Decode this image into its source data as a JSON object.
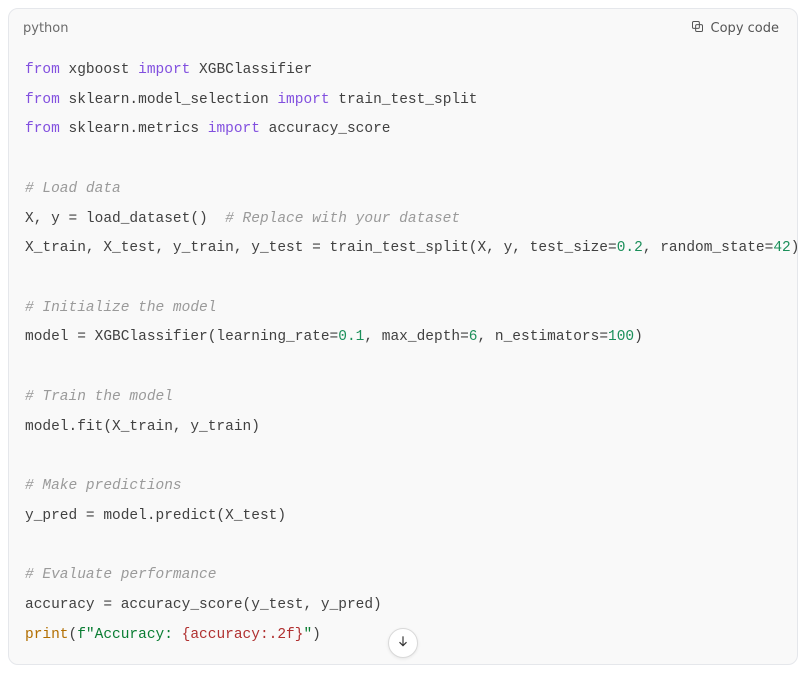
{
  "header": {
    "language": "python",
    "copy_label": "Copy code"
  },
  "code": {
    "lines": [
      "from xgboost import XGBClassifier",
      "from sklearn.model_selection import train_test_split",
      "from sklearn.metrics import accuracy_score",
      "",
      "# Load data",
      "X, y = load_dataset()  # Replace with your dataset",
      "X_train, X_test, y_train, y_test = train_test_split(X, y, test_size=0.2, random_state=42)",
      "",
      "# Initialize the model",
      "model = XGBClassifier(learning_rate=0.1, max_depth=6, n_estimators=100)",
      "",
      "# Train the model",
      "model.fit(X_train, y_train)",
      "",
      "# Make predictions",
      "y_pred = model.predict(X_test)",
      "",
      "# Evaluate performance",
      "accuracy = accuracy_score(y_test, y_pred)",
      "print(f\"Accuracy: {accuracy:.2f}\")"
    ],
    "tokens_by_line": [
      [
        [
          "kw",
          "from"
        ],
        [
          "nm",
          " xgboost "
        ],
        [
          "kw",
          "import"
        ],
        [
          "nm",
          " XGBClassifier"
        ]
      ],
      [
        [
          "kw",
          "from"
        ],
        [
          "nm",
          " sklearn.model_selection "
        ],
        [
          "kw",
          "import"
        ],
        [
          "nm",
          " train_test_split"
        ]
      ],
      [
        [
          "kw",
          "from"
        ],
        [
          "nm",
          " sklearn.metrics "
        ],
        [
          "kw",
          "import"
        ],
        [
          "nm",
          " accuracy_score"
        ]
      ],
      [],
      [
        [
          "cm",
          "# Load data"
        ]
      ],
      [
        [
          "nm",
          "X, y = load_dataset()  "
        ],
        [
          "cm",
          "# Replace with your dataset"
        ]
      ],
      [
        [
          "nm",
          "X_train, X_test, y_train, y_test = train_test_split(X, y, test_size="
        ],
        [
          "num",
          "0.2"
        ],
        [
          "nm",
          ", random_state="
        ],
        [
          "num",
          "42"
        ],
        [
          "nm",
          ")"
        ]
      ],
      [],
      [
        [
          "cm",
          "# Initialize the model"
        ]
      ],
      [
        [
          "nm",
          "model = XGBClassifier(learning_rate="
        ],
        [
          "num",
          "0.1"
        ],
        [
          "nm",
          ", max_depth="
        ],
        [
          "num",
          "6"
        ],
        [
          "nm",
          ", n_estimators="
        ],
        [
          "num",
          "100"
        ],
        [
          "nm",
          ")"
        ]
      ],
      [],
      [
        [
          "cm",
          "# Train the model"
        ]
      ],
      [
        [
          "nm",
          "model.fit(X_train, y_train)"
        ]
      ],
      [],
      [
        [
          "cm",
          "# Make predictions"
        ]
      ],
      [
        [
          "nm",
          "y_pred = model.predict(X_test)"
        ]
      ],
      [],
      [
        [
          "cm",
          "# Evaluate performance"
        ]
      ],
      [
        [
          "nm",
          "accuracy = accuracy_score(y_test, y_pred)"
        ]
      ],
      [
        [
          "fn",
          "print"
        ],
        [
          "nm",
          "("
        ],
        [
          "str",
          "f\"Accuracy: "
        ],
        [
          "fs",
          "{accuracy:.2f}"
        ],
        [
          "str",
          "\""
        ],
        [
          "nm",
          ")"
        ]
      ]
    ]
  }
}
